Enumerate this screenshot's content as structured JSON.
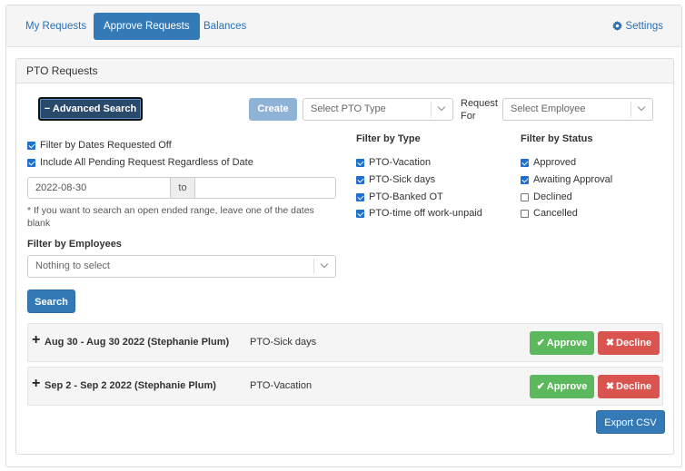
{
  "nav": {
    "tabs": [
      {
        "label": "My Requests",
        "active": false
      },
      {
        "label": "Approve Requests",
        "active": true
      },
      {
        "label": "Balances",
        "active": false
      }
    ],
    "settings_label": "Settings"
  },
  "panel": {
    "title": "PTO Requests",
    "advanced_search_label": "− Advanced Search",
    "create_label": "Create",
    "pto_type_placeholder": "Select PTO Type",
    "request_for_label_1": "Request",
    "request_for_label_2": "For",
    "employee_placeholder": "Select Employee"
  },
  "filters": {
    "dates_requested_label": "Filter by Dates Requested Off",
    "include_pending_label": "Include All Pending Request Regardless of Date",
    "date_from": "2022-08-30",
    "date_to_label": "to",
    "date_to": "",
    "hint": "* If you want to search an open ended range, leave one of the dates blank",
    "employees_label": "Filter by Employees",
    "employees_placeholder": "Nothing to select",
    "search_label": "Search",
    "type_heading": "Filter by Type",
    "types": [
      {
        "label": "PTO-Vacation",
        "checked": true
      },
      {
        "label": "PTO-Sick days",
        "checked": true
      },
      {
        "label": "PTO-Banked OT",
        "checked": true
      },
      {
        "label": "PTO-time off work-unpaid",
        "checked": true
      }
    ],
    "status_heading": "Filter by Status",
    "statuses": [
      {
        "label": "Approved",
        "checked": true
      },
      {
        "label": "Awaiting Approval",
        "checked": true
      },
      {
        "label": "Declined",
        "checked": false
      },
      {
        "label": "Cancelled",
        "checked": false
      }
    ]
  },
  "requests": [
    {
      "dates": "Aug 30 - Aug 30 2022 (Stephanie Plum)",
      "type": "PTO-Sick days",
      "approve": "Approve",
      "decline": "Decline"
    },
    {
      "dates": "Sep 2 - Sep 2 2022 (Stephanie Plum)",
      "type": "PTO-Vacation",
      "approve": "Approve",
      "decline": "Decline"
    }
  ],
  "export_label": "Export CSV",
  "colors": {
    "primary": "#337ab7",
    "success": "#5cb85c",
    "danger": "#d9534f"
  }
}
